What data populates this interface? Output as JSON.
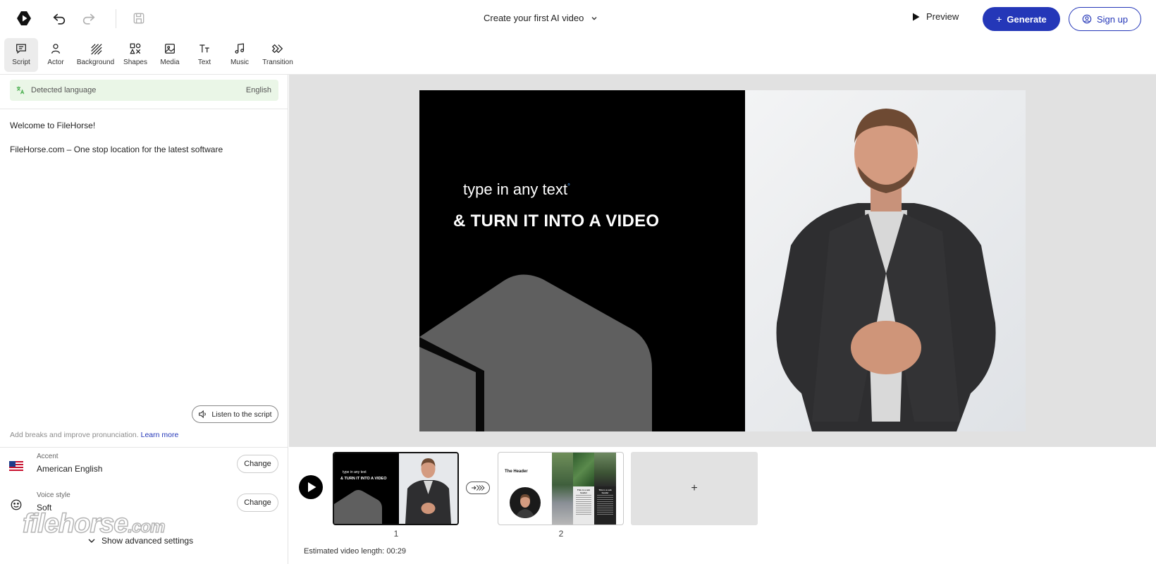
{
  "header": {
    "title": "Create your first AI video",
    "preview_label": "Preview",
    "generate_label": "Generate",
    "signup_label": "Sign up"
  },
  "toolbar": {
    "items": [
      {
        "label": "Script",
        "icon": "script-icon",
        "active": true
      },
      {
        "label": "Actor",
        "icon": "actor-icon"
      },
      {
        "label": "Background",
        "icon": "background-icon"
      },
      {
        "label": "Shapes",
        "icon": "shapes-icon"
      },
      {
        "label": "Media",
        "icon": "media-icon"
      },
      {
        "label": "Text",
        "icon": "text-icon"
      },
      {
        "label": "Music",
        "icon": "music-icon"
      },
      {
        "label": "Transition",
        "icon": "transition-icon"
      }
    ]
  },
  "script_panel": {
    "detected_language_label": "Detected language",
    "detected_language_value": "English",
    "script_lines": [
      "Welcome to FileHorse!",
      "FileHorse.com – One stop location for the latest software"
    ],
    "listen_label": "Listen to the script",
    "hint_text": "Add breaks and improve pronunciation.",
    "hint_link": "Learn more",
    "accent_label": "Accent",
    "accent_value": "American English",
    "voice_style_label": "Voice style",
    "voice_style_value": "Soft",
    "change_label": "Change",
    "advanced_label": "Show advanced settings",
    "watermark_text": "filehorse",
    "watermark_suffix": ".com"
  },
  "canvas": {
    "line1": "type in any text",
    "line1_mark": "°",
    "line2": "& TURN IT INTO A VIDEO"
  },
  "timeline": {
    "scenes": [
      {
        "number": "1",
        "selected": true,
        "line1": "type in any text",
        "line2": "& TURN IT INTO A VIDEO"
      },
      {
        "number": "2",
        "selected": false,
        "header": "The Header",
        "sub_header": "This is a sub header"
      }
    ],
    "add_label": "+",
    "estimate_label": "Estimated video length:",
    "estimate_value": "00:29"
  },
  "colors": {
    "accent": "#2437b8",
    "language_bg": "#eaf6e7",
    "canvas_bg": "#e1e1e1"
  }
}
